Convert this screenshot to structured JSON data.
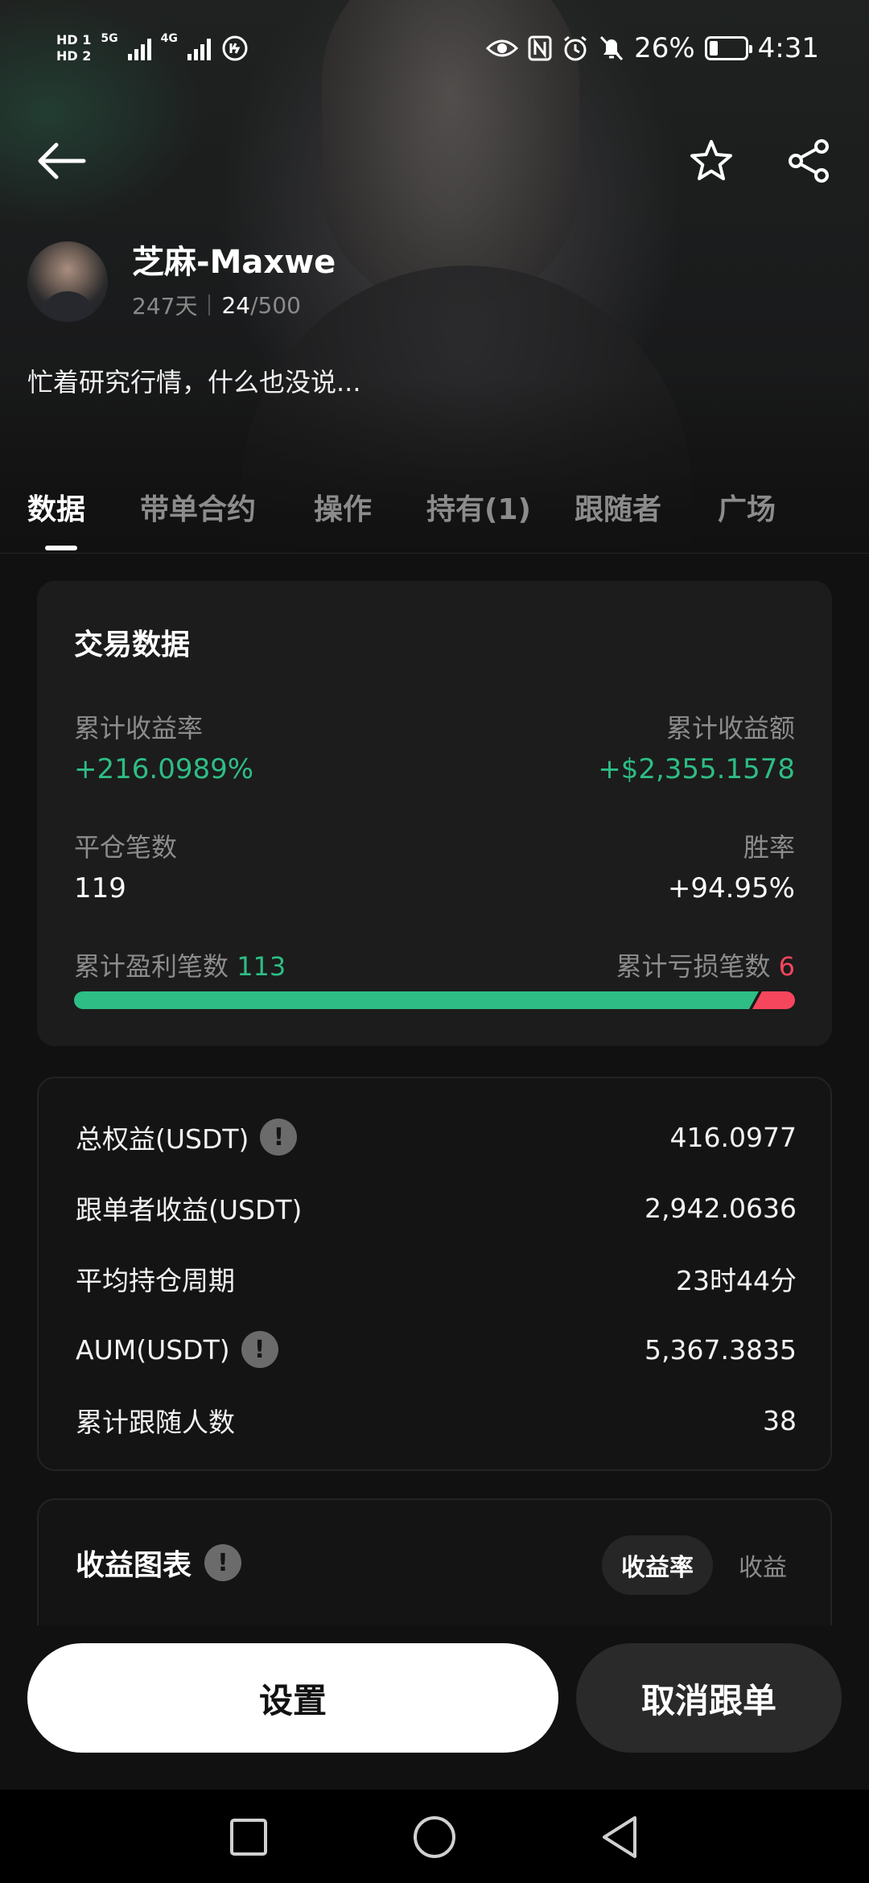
{
  "status_bar": {
    "time": "4:31",
    "battery_percent": "26%",
    "hd1": "HD 1",
    "hd2": "HD 2",
    "net1": "5G",
    "net2": "4G",
    "icons": [
      "eye-icon",
      "nfc-icon",
      "alarm-icon",
      "mute-bell-icon",
      "battery-icon"
    ]
  },
  "profile": {
    "name": "芝麻-Maxwe",
    "days": "247天",
    "followers_current": "24",
    "followers_max": "/500",
    "bio": "忙着研究行情，什么也没说..."
  },
  "tabs": [
    {
      "label": "数据",
      "active": true
    },
    {
      "label": "带单合约"
    },
    {
      "label": "操作"
    },
    {
      "label": "持有(1)"
    },
    {
      "label": "跟随者"
    },
    {
      "label": "广场"
    }
  ],
  "trade_data": {
    "title": "交易数据",
    "cum_return_label": "累计收益率",
    "cum_return_value": "+216.0989%",
    "cum_profit_label": "累计收益额",
    "cum_profit_value": "+$2,355.1578",
    "closed_trades_label": "平仓笔数",
    "closed_trades_value": "119",
    "win_rate_label": "胜率",
    "win_rate_value": "+94.95%",
    "win_count_label": "累计盈利笔数",
    "win_count_value": "113",
    "loss_count_label": "累计亏损笔数",
    "loss_count_value": "6",
    "win_fraction": 0.95
  },
  "stats": [
    {
      "label": "总权益(USDT)",
      "value": "416.0977",
      "info": true
    },
    {
      "label": "跟单者收益(USDT)",
      "value": "2,942.0636",
      "info": false
    },
    {
      "label": "平均持仓周期",
      "value": "23时44分",
      "info": false
    },
    {
      "label": "AUM(USDT)",
      "value": "5,367.3835",
      "info": true
    },
    {
      "label": "累计跟随人数",
      "value": "38",
      "info": false
    }
  ],
  "info_glyph": "!",
  "chart": {
    "title": "收益图表",
    "toggle_active": "收益率",
    "toggle_inactive": "收益"
  },
  "actions": {
    "primary": "设置",
    "secondary": "取消跟单"
  },
  "colors": {
    "profit": "#2ebd85",
    "loss": "#f6465d",
    "background": "#111111"
  }
}
